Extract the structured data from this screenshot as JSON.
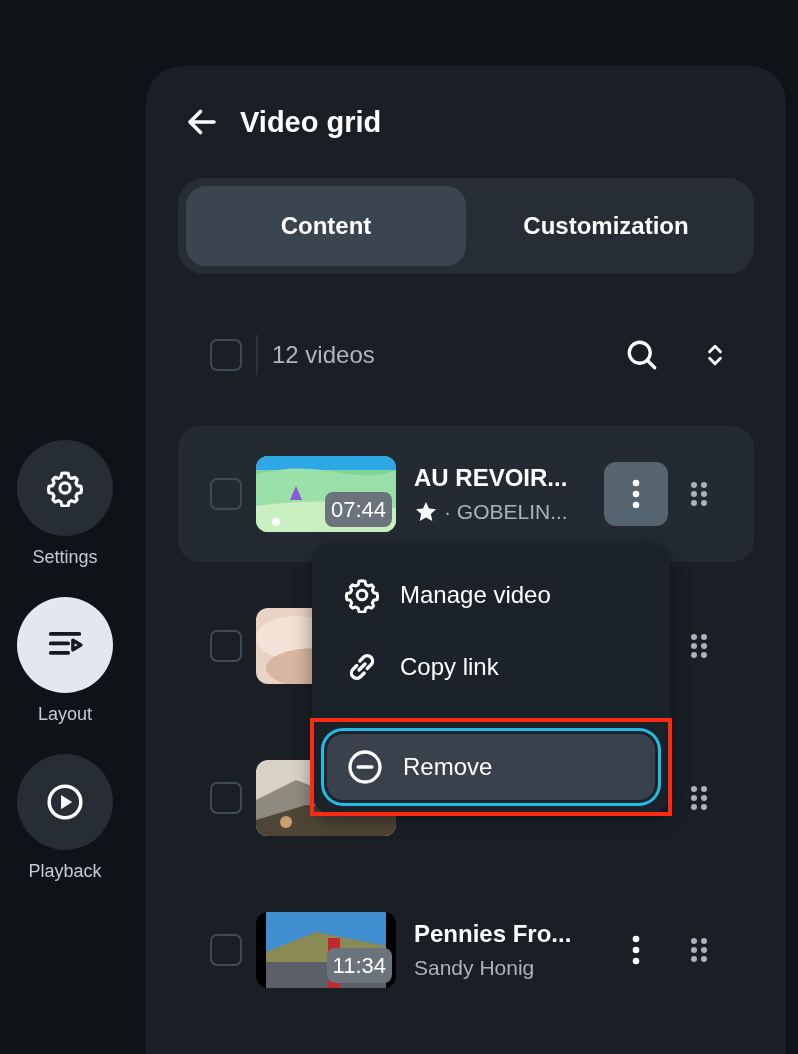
{
  "rail": [
    {
      "label": "Settings",
      "selected": false
    },
    {
      "label": "Layout",
      "selected": true
    },
    {
      "label": "Playback",
      "selected": false
    }
  ],
  "panel": {
    "title": "Video grid",
    "tabs": [
      {
        "label": "Content",
        "selected": true
      },
      {
        "label": "Customization",
        "selected": false
      }
    ],
    "list_header": {
      "count": "12 videos",
      "checked": false
    },
    "videos": [
      {
        "kind": "full",
        "checked": false,
        "selected": true,
        "title": "AU REVOIR...",
        "starred": true,
        "subtitle": "· GOBELIN...",
        "duration": "07:44",
        "menu_open": true
      },
      {
        "kind": "covered",
        "checked": false,
        "selected": false
      },
      {
        "kind": "covered",
        "checked": false,
        "selected": false
      },
      {
        "kind": "full",
        "checked": false,
        "selected": false,
        "title": "Pennies Fro...",
        "starred": false,
        "subtitle": "Sandy Honig",
        "duration": "11:34",
        "menu_open": false
      }
    ]
  },
  "menu": {
    "items": [
      {
        "label": "Manage video",
        "focused": false,
        "highlighted": false
      },
      {
        "label": "Copy link",
        "focused": false,
        "highlighted": false
      },
      {
        "label": "Remove",
        "focused": true,
        "highlighted": true
      }
    ]
  }
}
